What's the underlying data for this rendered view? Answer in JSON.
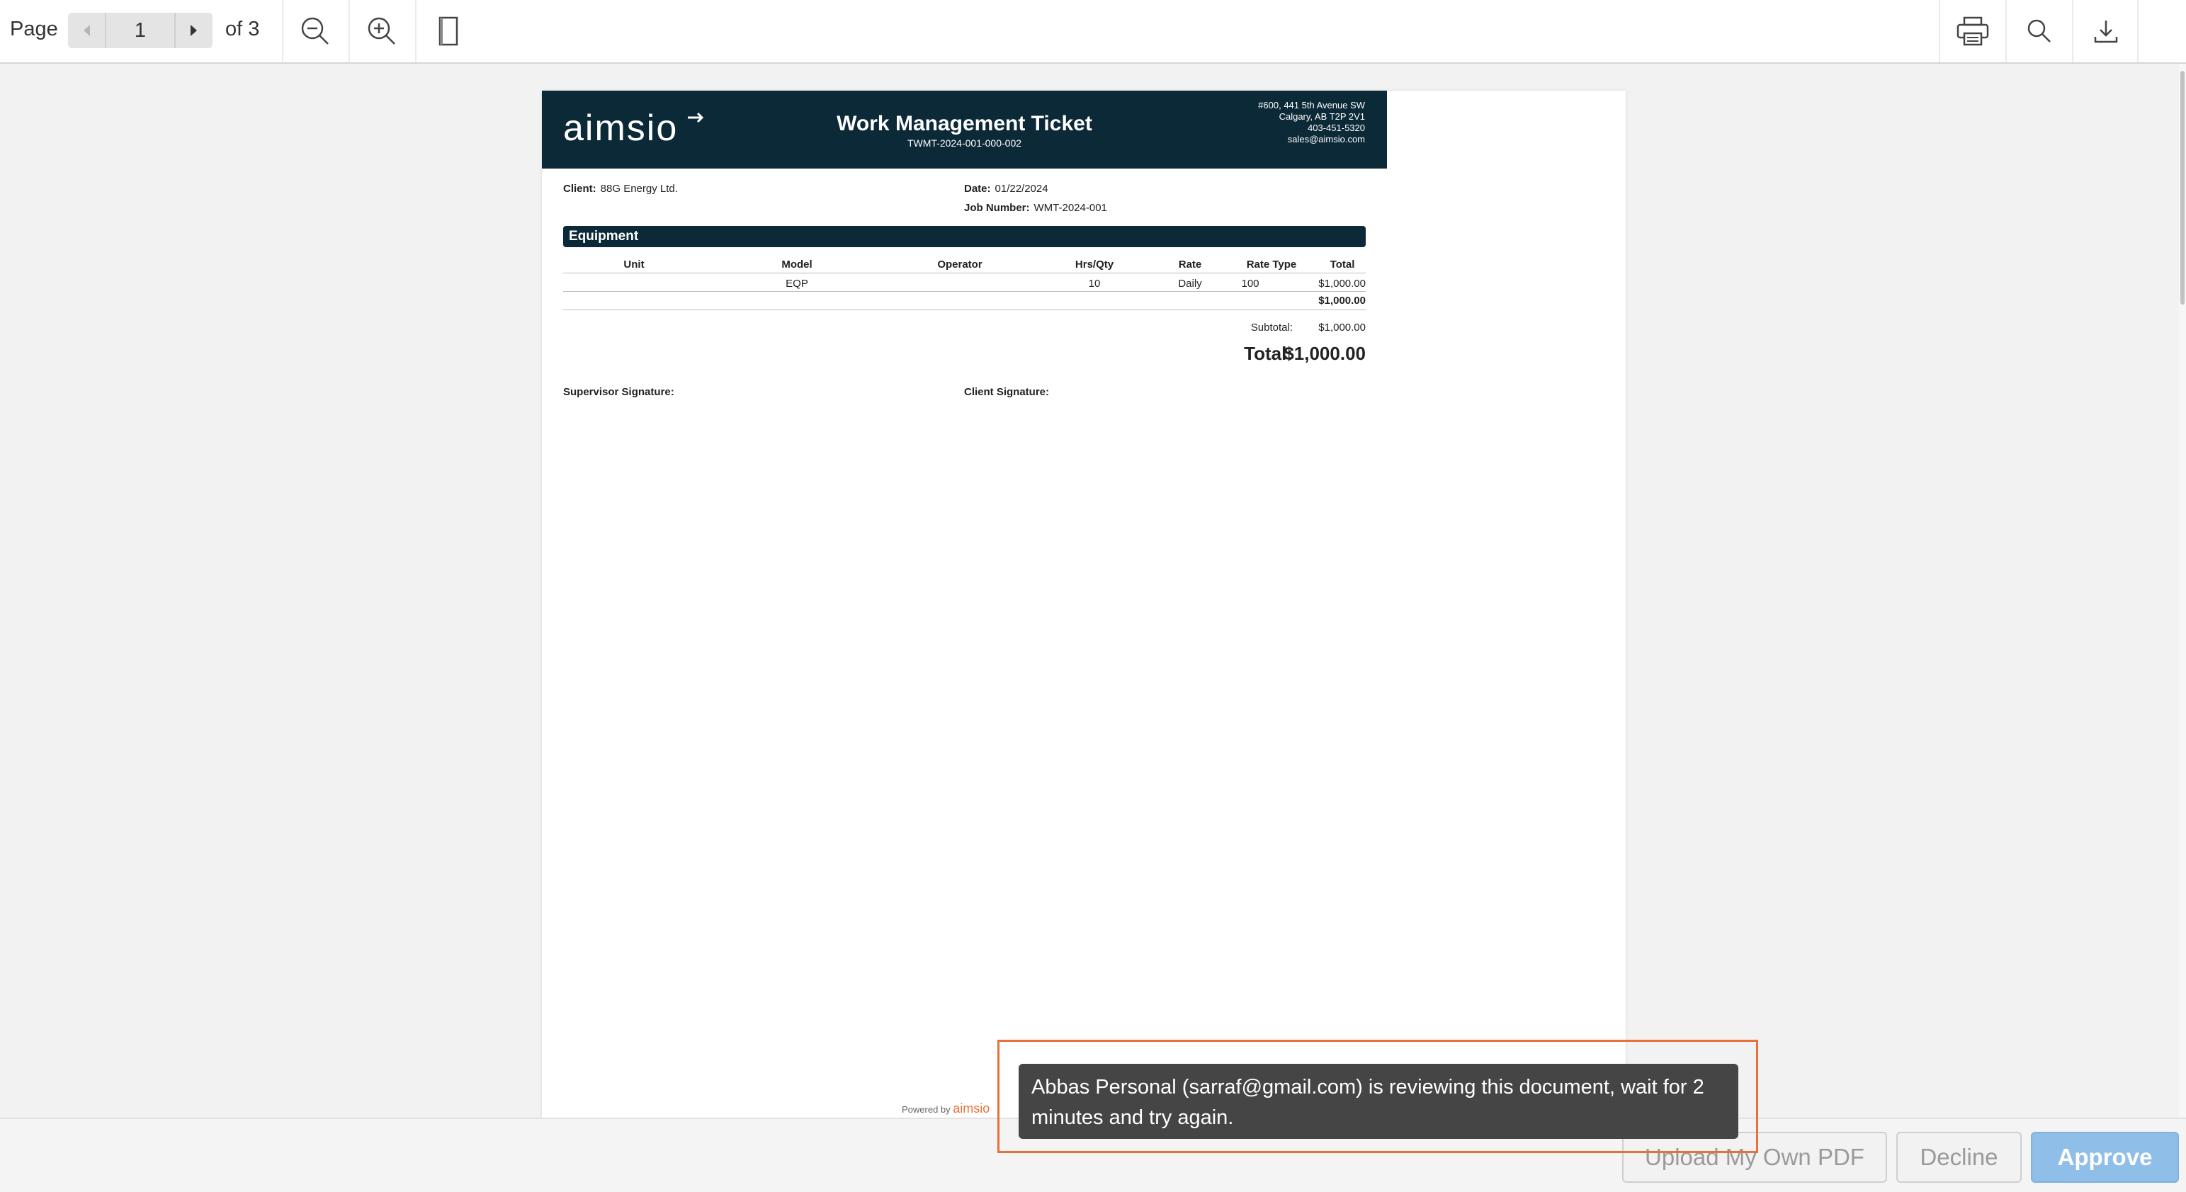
{
  "toolbar": {
    "page_label": "Page",
    "current_page": "1",
    "of_label": "of 3",
    "icons": [
      "chevron-left-icon",
      "chevron-right-icon",
      "zoom-out-icon",
      "zoom-in-icon",
      "page-view-icon",
      "printer-icon",
      "search-icon",
      "download-icon"
    ]
  },
  "document": {
    "logo_text": "aimsio",
    "title": "Work Management Ticket",
    "ticket_id": "TWMT-2024-001-000-002",
    "address": [
      "#600, 441 5th Avenue SW",
      "Calgary, AB T2P 2V1",
      "403-451-5320",
      "sales@aimsio.com"
    ],
    "client_label": "Client:",
    "client_value": "88G Energy Ltd.",
    "date_label": "Date:",
    "date_value": "01/22/2024",
    "job_label": "Job Number:",
    "job_value": "WMT-2024-001",
    "section_title": "Equipment",
    "columns": [
      "Unit",
      "Model",
      "Operator",
      "Hrs/Qty",
      "Rate",
      "Rate Type",
      "Total"
    ],
    "row": {
      "unit": "",
      "model": "EQP",
      "operator": "",
      "hrs": "10",
      "rate": "Daily",
      "rate_type": "100",
      "total": "$1,000.00"
    },
    "section_total": "$1,000.00",
    "subtotal_label": "Subtotal:",
    "subtotal_value": "$1,000.00",
    "total_label": "Total:",
    "total_value": "$1,000.00",
    "supervisor_sig_label": "Supervisor Signature:",
    "client_sig_label": "Client Signature:",
    "powered_by": "Powered by",
    "powered_logo": "aimsio"
  },
  "toast": {
    "message": "Abbas Personal (sarraf@gmail.com) is reviewing this document, wait for 2 minutes and try again."
  },
  "actions": {
    "upload_label": "Upload My Own PDF",
    "decline_label": "Decline",
    "approve_label": "Approve"
  },
  "colors": {
    "header_navy": "#0c2937",
    "approve_blue": "#8fbfe8",
    "highlight_orange": "#e8703a",
    "toast_bg": "#454545"
  }
}
